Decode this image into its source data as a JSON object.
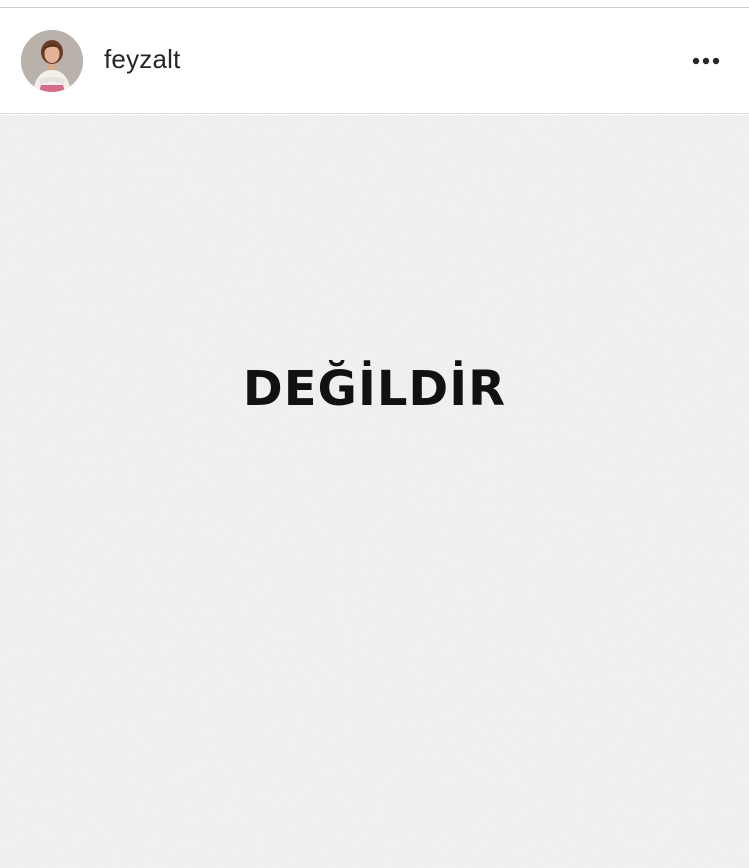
{
  "post": {
    "username": "feyzalt",
    "image_text": "DEĞİLDİR"
  },
  "icons": {
    "avatar": "profile-photo",
    "more": "more-horizontal-icon"
  },
  "colors": {
    "text": "#262626",
    "image_background": "#f1f1f1",
    "image_text": "#111111"
  }
}
